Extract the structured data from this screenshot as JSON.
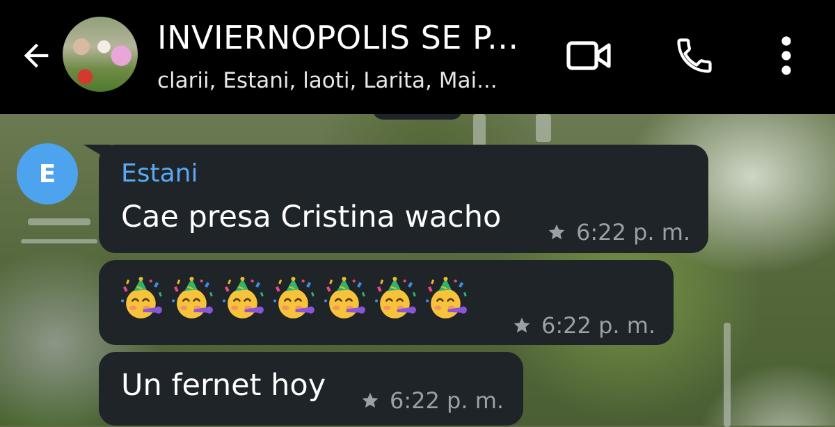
{
  "header": {
    "title": "INVIERNOPOLIS SE P...",
    "subtitle": "clarii, Estani, laoti, Larita, Mai...",
    "icons": {
      "back": "arrow-back-icon",
      "avatar": "group-avatar",
      "video": "video-call-icon",
      "call": "phone-icon",
      "more": "more-vert-icon"
    }
  },
  "messages": [
    {
      "sender_initial": "E",
      "sender_name": "Estani",
      "text": "Cae presa Cristina wacho",
      "time": "6:22 p. m.",
      "starred": true
    },
    {
      "emoji_icon": "partying-face-emoji",
      "emoji_count": 7,
      "time": "6:22 p. m.",
      "starred": true
    },
    {
      "text": "Un fernet hoy",
      "time": "6:22 p. m.",
      "starred": true
    }
  ],
  "colors": {
    "appbar": "#000000",
    "bubble": "#1f2429",
    "sender_name": "#5aa9f2",
    "avatar_bg": "#4ea3ef",
    "meta_text": "#9aa0a6"
  }
}
